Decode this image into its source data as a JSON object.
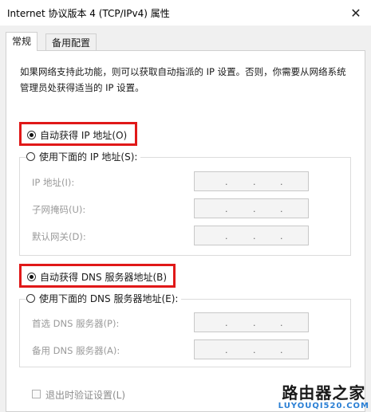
{
  "window": {
    "title": "Internet 协议版本 4 (TCP/IPv4) 属性",
    "close_glyph": "✕"
  },
  "tabs": [
    {
      "label": "常规",
      "selected": true
    },
    {
      "label": "备用配置",
      "selected": false
    }
  ],
  "description": "如果网络支持此功能，则可以获取自动指派的 IP 设置。否则，你需要从网络系统管理员处获得适当的 IP 设置。",
  "ip": {
    "auto_label": "自动获得 IP 地址(O)",
    "manual_label": "使用下面的 IP 地址(S):",
    "selected": "auto",
    "fields": [
      {
        "label": "IP 地址(I):",
        "value": ". . ."
      },
      {
        "label": "子网掩码(U):",
        "value": ". . ."
      },
      {
        "label": "默认网关(D):",
        "value": ". . ."
      }
    ]
  },
  "dns": {
    "auto_label": "自动获得 DNS 服务器地址(B)",
    "manual_label": "使用下面的 DNS 服务器地址(E):",
    "selected": "auto",
    "fields": [
      {
        "label": "首选 DNS 服务器(P):",
        "value": ". . ."
      },
      {
        "label": "备用 DNS 服务器(A):",
        "value": ". . ."
      }
    ]
  },
  "validate": {
    "label": "退出时验证设置(L)",
    "checked": false,
    "enabled": false
  },
  "watermark": {
    "main": "路由器之家",
    "sub": "LUYOUQI520.COM"
  },
  "colors": {
    "highlight": "#e01818",
    "panel": "#ffffff",
    "background": "#f0f0f0"
  }
}
